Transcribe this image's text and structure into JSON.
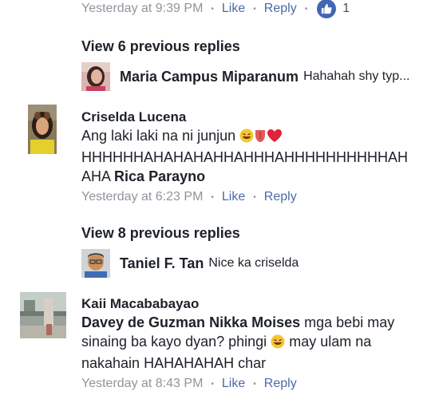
{
  "top_meta": {
    "time": "Yesterday at 9:39 PM",
    "like": "Like",
    "reply": "Reply",
    "like_count": "1"
  },
  "thread1": {
    "view_replies": "View 6 previous replies",
    "reply": {
      "name": "Maria Campus Miparanum",
      "text": "Hahahah shy typ..."
    }
  },
  "comment1": {
    "name": "Criselda Lucena",
    "line1": "Ang laki laki na ni junjun",
    "line2": "HHHHHHAHAHAHAHHAHHHAHHHHHHHHHHAH",
    "line3": "AHA",
    "tag": "Rica Parayno",
    "meta": {
      "time": "Yesterday at 6:23 PM",
      "like": "Like",
      "reply": "Reply"
    }
  },
  "thread2": {
    "view_replies": "View 8 previous replies",
    "reply": {
      "name": "Taniel F. Tan",
      "text": "Nice ka criselda"
    }
  },
  "comment2": {
    "name": "Kaii Macababayao",
    "tag1": "Davey de Guzman",
    "tag2": "Nikka Moises",
    "text1": "mga bebi may",
    "text2": "sinaing ba kayo dyan? phingi",
    "text3": "may ulam na",
    "text4": "nakahain HAHAHAHAH char",
    "meta": {
      "time": "Yesterday at 8:43 PM",
      "like": "Like",
      "reply": "Reply"
    }
  },
  "icons": [
    "thumbs-up-icon",
    "laughing-emoji",
    "tongue-emoji",
    "heart-emoji"
  ],
  "colors": {
    "link": "#4b6aa8",
    "muted": "#90949c",
    "like_badge": "#4267b2",
    "text": "#1d2129"
  }
}
